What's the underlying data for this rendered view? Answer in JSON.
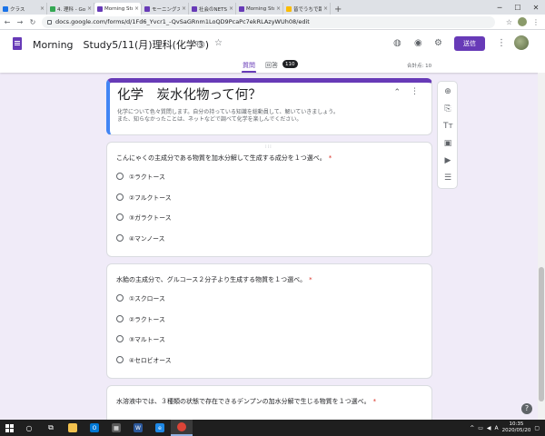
{
  "browser": {
    "tabs": [
      {
        "label": "クラス",
        "color": "#1a73e8"
      },
      {
        "label": "4. 理科 - Google",
        "color": "#34a853"
      },
      {
        "label": "Morning Study",
        "color": "#673ab7",
        "active": true
      },
      {
        "label": "モーニングスタディ",
        "color": "#673ab7"
      },
      {
        "label": "社会のNETSTUD",
        "color": "#673ab7"
      },
      {
        "label": "Morning Study",
        "color": "#673ab7"
      },
      {
        "label": "皆でうちで踊ろう",
        "color": "#fbbc04"
      }
    ],
    "new_tab": "+",
    "url": "docs.google.com/forms/d/1Fd6_Yvcr1_-QvSaGRnm1LoQD9PcaPc7ekRLAzyWUh08/edit"
  },
  "header": {
    "title": "Morning　Study5/11(月)理科(化学③)",
    "send_label": "送信",
    "tabs": {
      "questions": "質問",
      "responses": "回答",
      "response_count": "110"
    },
    "points": "合計点: 10"
  },
  "form": {
    "title": "化学　炭水化物って何？",
    "description_1": "化学について色々質問します。自分の持っている知識を総動員して、解いていきましょう。",
    "description_2": "また、知らなかったことは、ネットなどで調べて化学を楽しんでください。"
  },
  "questions": [
    {
      "text": "こんにゃくの主成分である物質を加水分解して生成する成分を１つ選べ。",
      "required": "*",
      "options": [
        "①ラクトース",
        "②フルクトース",
        "③ガラクトース",
        "④マンノース"
      ]
    },
    {
      "text": "水飴の主成分で、グルコース２分子より生成する物質を１つ選べ。",
      "required": "*",
      "options": [
        "①スクロース",
        "②ラクトース",
        "③マルトース",
        "④セロビオース"
      ]
    },
    {
      "text": "水溶液中では、３種類の状態で存在できるデンプンの加水分解で生じる物質を１つ選べ。",
      "required": "*",
      "options": []
    }
  ],
  "taskbar": {
    "time": "10:35",
    "date": "2020/05/20"
  },
  "colors": {
    "accent": "#673ab7",
    "required": "#d93025"
  }
}
